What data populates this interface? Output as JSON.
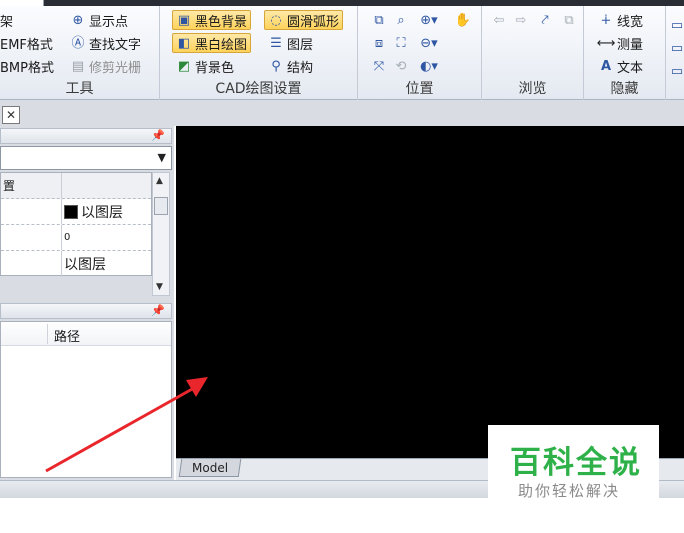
{
  "ribbon": {
    "tools": {
      "label": "工具",
      "items": [
        {
          "label": "架",
          "icon": "frame-icon"
        },
        {
          "label": "EMF格式",
          "icon": "emf-icon"
        },
        {
          "label": "BMP格式",
          "icon": "bmp-icon"
        },
        {
          "label": "显示点",
          "icon": "show-points-icon"
        },
        {
          "label": "查找文字",
          "icon": "find-text-icon"
        },
        {
          "label": "修剪光栅",
          "icon": "trim-raster-icon",
          "disabled": true
        }
      ]
    },
    "cad": {
      "label": "CAD绘图设置",
      "items": [
        {
          "label": "黑色背景",
          "icon": "black-background-icon",
          "active": true
        },
        {
          "label": "黑白绘图",
          "icon": "black-white-icon",
          "active": true
        },
        {
          "label": "背景色",
          "icon": "background-color-icon"
        },
        {
          "label": "圆滑弧形",
          "icon": "smooth-arc-icon",
          "active": true
        },
        {
          "label": "图层",
          "icon": "layers-icon"
        },
        {
          "label": "结构",
          "icon": "structure-icon"
        }
      ]
    },
    "position": {
      "label": "位置"
    },
    "browse": {
      "label": "浏览"
    },
    "hide": {
      "label": "隐藏",
      "items": [
        {
          "label": "线宽",
          "icon": "line-width-icon"
        },
        {
          "label": "测量",
          "icon": "measure-icon"
        },
        {
          "label": "文本",
          "icon": "text-icon"
        }
      ]
    }
  },
  "properties": {
    "header_key": "置",
    "rows": [
      {
        "key": "",
        "value": "以图层",
        "swatch": "#000000"
      },
      {
        "key": "",
        "value": "0"
      },
      {
        "key": "",
        "value": "以图层"
      }
    ]
  },
  "filelist": {
    "columns": [
      "路径"
    ]
  },
  "canvas": {
    "background": "#000000",
    "tab": "Model"
  },
  "watermark": {
    "title": "百科全说",
    "subtitle": "助你轻松解决",
    "title_color": "#2fb14a"
  },
  "annotation_arrow": {
    "color": "#e8262b"
  }
}
